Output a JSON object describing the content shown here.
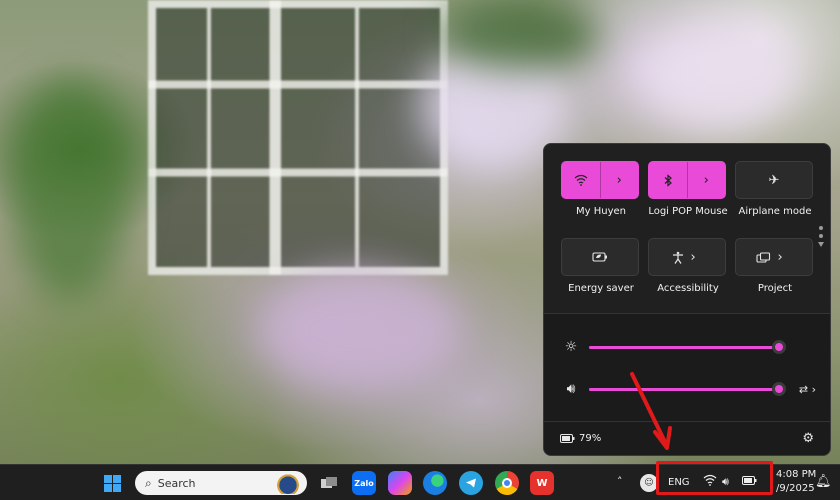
{
  "quick_settings": {
    "tiles": [
      {
        "label": "My Huyen",
        "icon": "wifi-icon",
        "state": "on",
        "has_chevron": true
      },
      {
        "label": "Logi POP Mouse",
        "icon": "bluetooth-icon",
        "state": "on",
        "has_chevron": true
      },
      {
        "label": "Airplane mode",
        "icon": "airplane-icon",
        "state": "off",
        "has_chevron": false
      },
      {
        "label": "Energy saver",
        "icon": "energy-saver-icon",
        "state": "off",
        "has_chevron": false
      },
      {
        "label": "Accessibility",
        "icon": "accessibility-icon",
        "state": "off",
        "has_chevron": true
      },
      {
        "label": "Project",
        "icon": "project-icon",
        "state": "off",
        "has_chevron": true
      }
    ],
    "brightness": {
      "icon": "brightness-icon",
      "level": 1.0
    },
    "volume": {
      "icon": "volume-icon",
      "level": 1.0
    },
    "battery_percent": "79%",
    "accent_color": "#e94bd8"
  },
  "taskbar": {
    "search_placeholder": "Search",
    "apps": [
      "windows-start-icon",
      "search-box",
      "task-view-icon",
      "zalo-icon",
      "copilot-icon",
      "edge-icon",
      "telegram-icon",
      "chrome-icon",
      "wps-icon"
    ],
    "zalo_label": "Zalo",
    "tray_language": "ENG",
    "clock_time": "4:08 PM",
    "clock_date": "/9/2025"
  },
  "annotation": {
    "highlight_color": "#e01a1a"
  }
}
